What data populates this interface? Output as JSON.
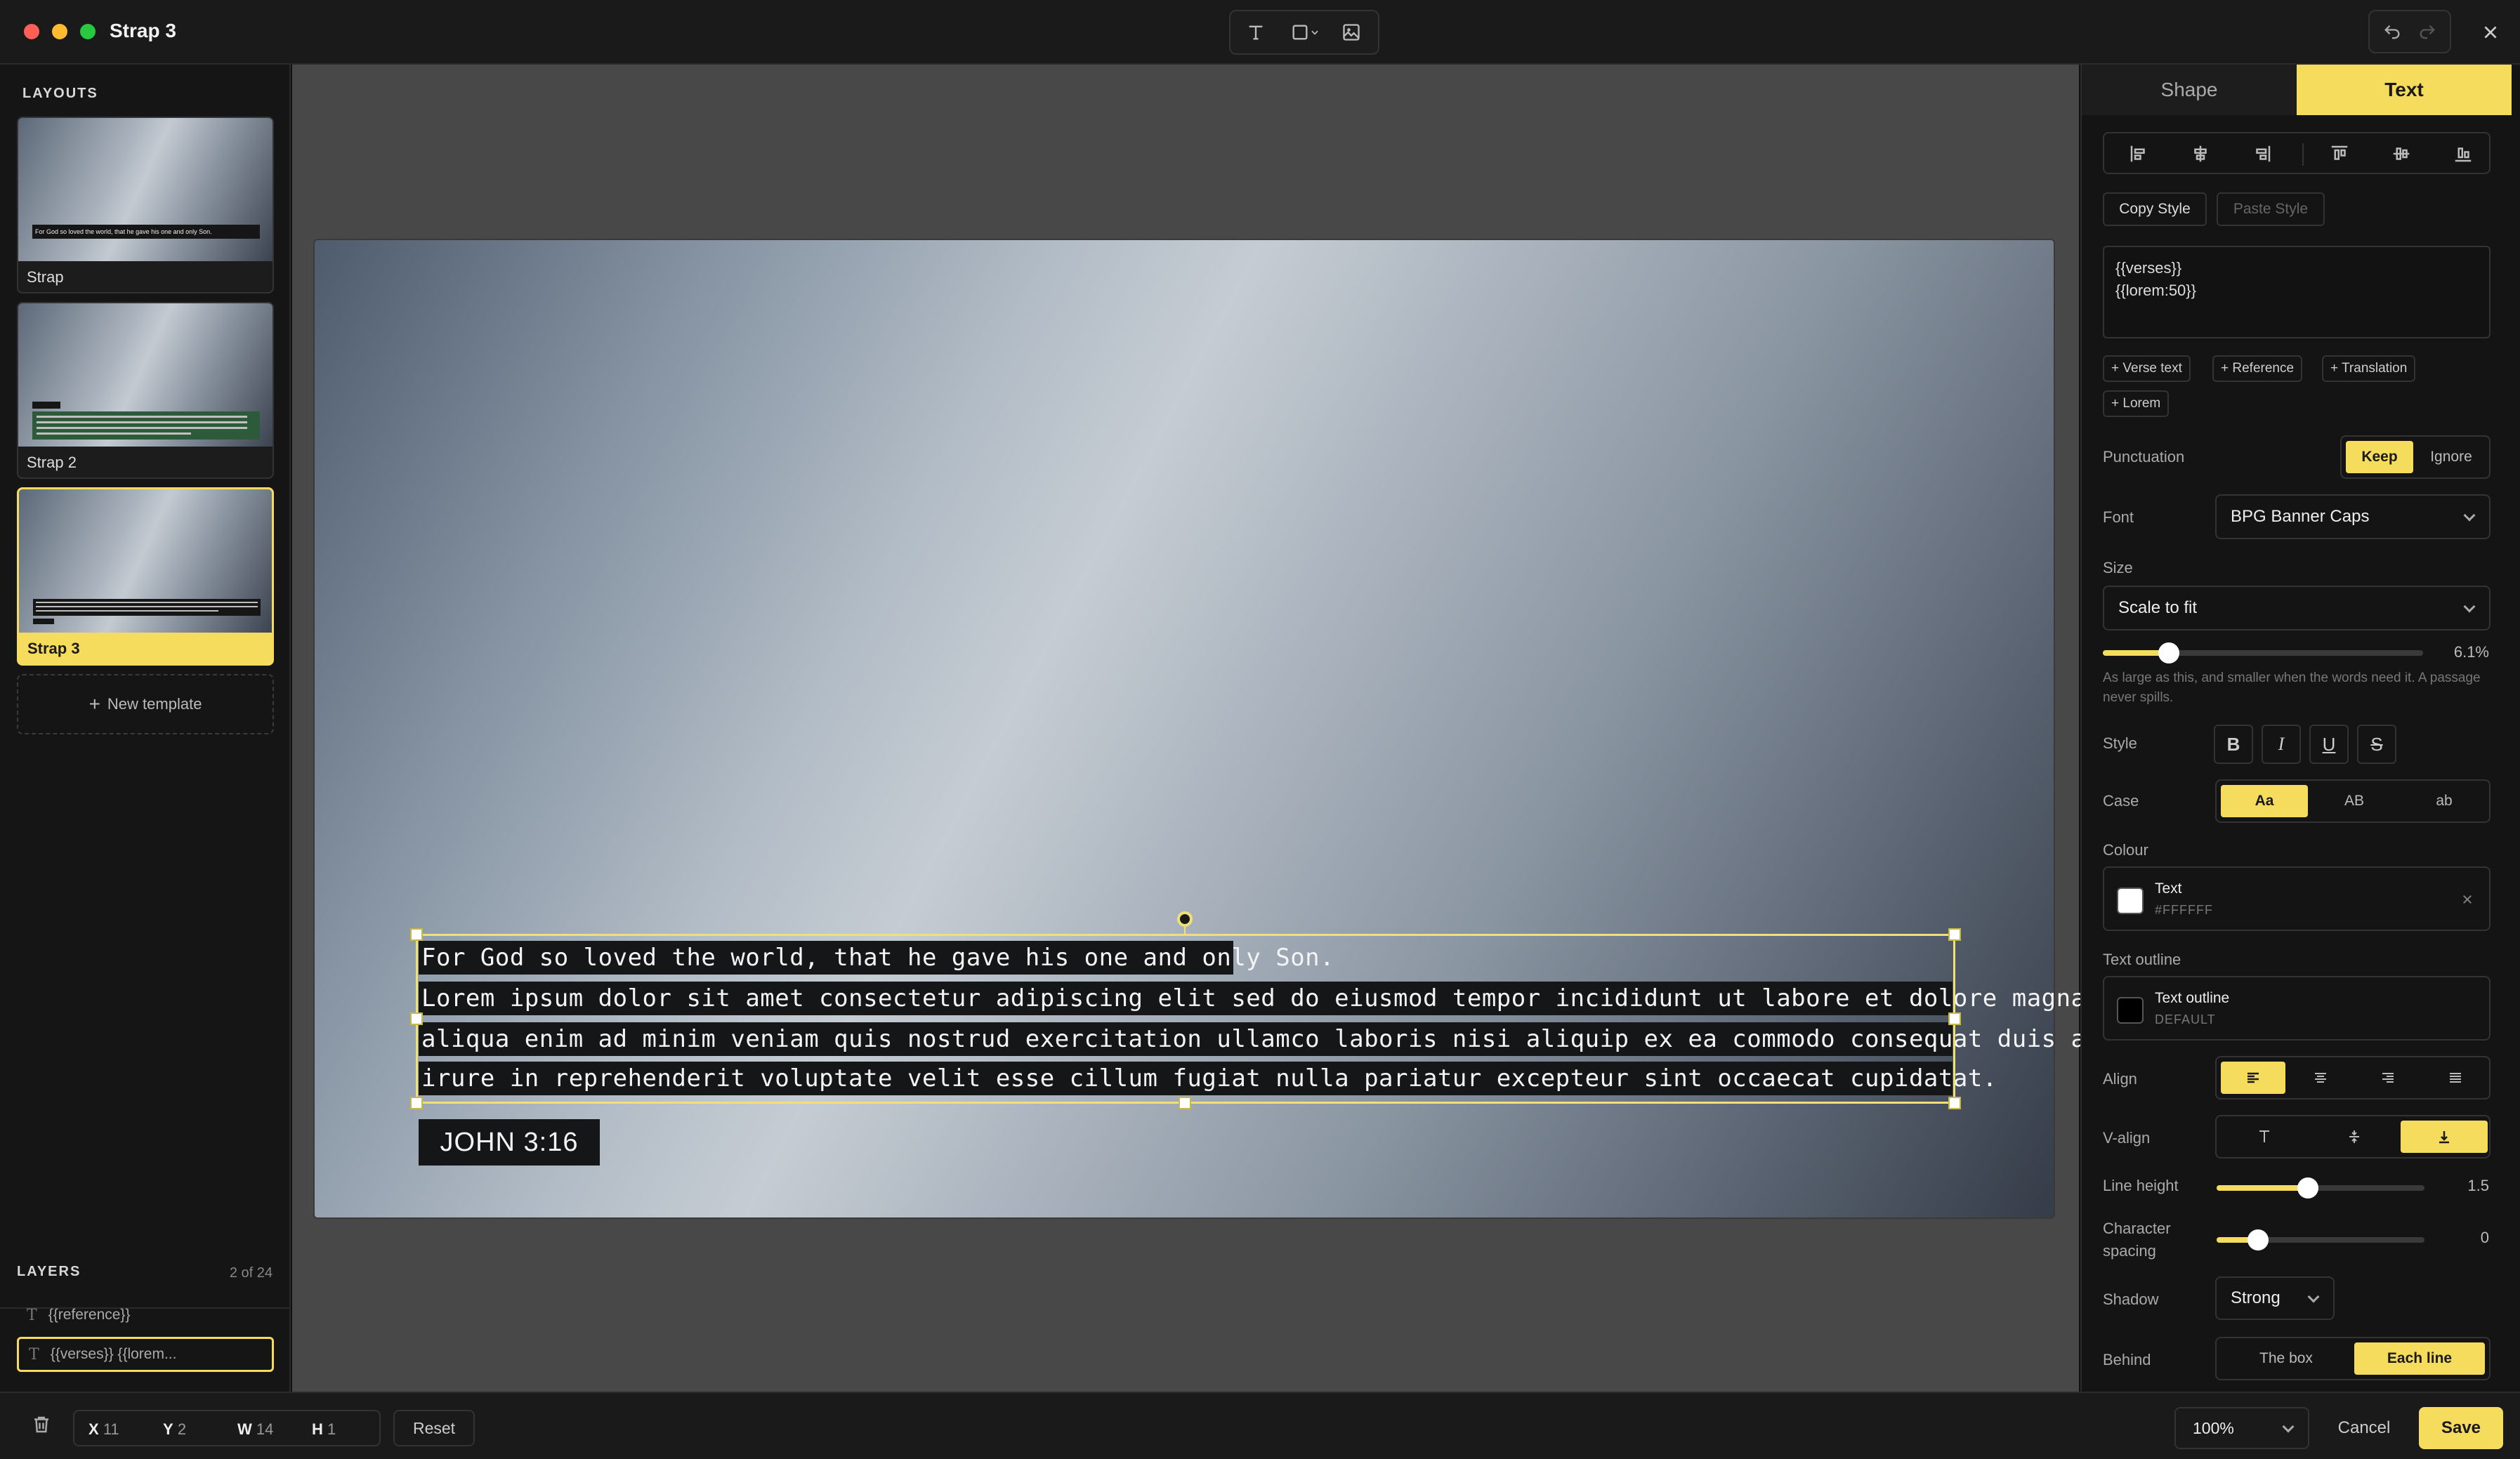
{
  "window": {
    "title": "Strap 3"
  },
  "colors": {
    "accent": "#F5DC5C",
    "text_colour": "#FFFFFF",
    "outline_colour": "#000000"
  },
  "toolbar": {
    "icons": [
      "text-icon",
      "shape-icon",
      "chevron-down-icon",
      "image-icon"
    ]
  },
  "sidebar": {
    "layouts_title": "LAYOUTS",
    "layouts": [
      {
        "label": "Strap",
        "thumb_text": "For God so loved the world, that he gave his one and only Son."
      },
      {
        "label": "Strap 2"
      },
      {
        "label": "Strap 3"
      }
    ],
    "new_template": "New template",
    "layers_title": "LAYERS",
    "layers_count": "2 of 24",
    "layers": [
      {
        "label": "{{reference}}"
      },
      {
        "label": "{{verses}} {{lorem..."
      }
    ]
  },
  "canvas": {
    "lines": [
      "For God so loved the world, that he gave his one and only Son.",
      "Lorem ipsum dolor sit amet consectetur adipiscing elit sed do eiusmod tempor incididunt ut labore et dolore magna",
      "aliqua enim ad minim veniam quis nostrud exercitation ullamco laboris nisi aliquip ex ea commodo consequat duis aute",
      "irure in reprehenderit voluptate velit esse cillum fugiat nulla pariatur excepteur sint occaecat cupidatat."
    ],
    "reference": "JOHN 3:16"
  },
  "panel": {
    "tabs": {
      "shape": "Shape",
      "text": "Text"
    },
    "copy_style": "Copy Style",
    "paste_style": "Paste Style",
    "template_text": "{{verses}}\n{{lorem:50}}",
    "chips": [
      "+ Verse text",
      "+ Reference",
      "+ Translation",
      "+ Lorem"
    ],
    "punctuation": {
      "label": "Punctuation",
      "options": [
        "Keep",
        "Ignore"
      ],
      "selected": "Keep"
    },
    "font": {
      "label": "Font",
      "value": "BPG Banner Caps"
    },
    "size": {
      "label": "Size",
      "mode": "Scale to fit",
      "value_label": "6.1%",
      "slider_fraction": 0.206,
      "hint": "As large as this, and smaller when the words need it. A passage never spills."
    },
    "style": {
      "label": "Style",
      "buttons": [
        "B",
        "I",
        "U",
        "S"
      ]
    },
    "case": {
      "label": "Case",
      "options": [
        "Aa",
        "AB",
        "ab"
      ],
      "selected": "Aa"
    },
    "colour": {
      "label": "Colour",
      "name": "Text",
      "hex": "#FFFFFF"
    },
    "outline": {
      "label": "Text outline",
      "name": "Text outline",
      "sub": "DEFAULT"
    },
    "align": {
      "label": "Align"
    },
    "valign": {
      "label": "V-align"
    },
    "line_height": {
      "label": "Line height",
      "value": "1.5",
      "slider_fraction": 0.44
    },
    "char_spacing": {
      "label": "Character\nspacing",
      "value": "0",
      "slider_fraction": 0.2
    },
    "shadow": {
      "label": "Shadow",
      "value": "Strong"
    },
    "behind": {
      "label": "Behind",
      "options": [
        "The box",
        "Each line"
      ],
      "selected": "Each line"
    }
  },
  "bottombar": {
    "x_label": "X",
    "x": "11",
    "y_label": "Y",
    "y": "2",
    "w_label": "W",
    "w": "14",
    "h_label": "H",
    "h": "1",
    "reset": "Reset",
    "zoom": "100%",
    "cancel": "Cancel",
    "save": "Save"
  }
}
